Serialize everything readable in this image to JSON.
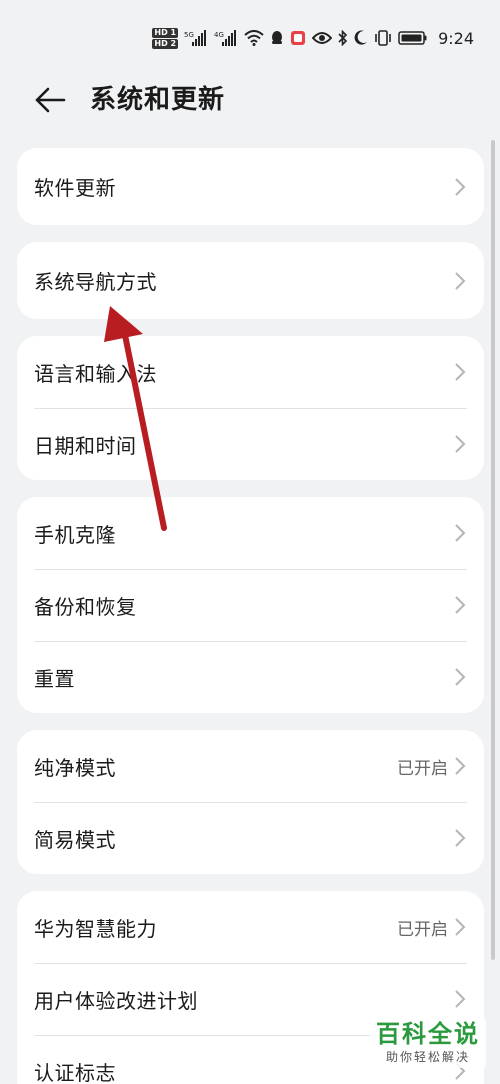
{
  "status_bar": {
    "hd_labels": [
      "HD 1",
      "HD 2"
    ],
    "network_1": "5G",
    "network_2": "4G",
    "time": "9:24",
    "icons": [
      "hd-icon",
      "signal-5g-icon",
      "signal-4g-icon",
      "wifi-icon",
      "qq-icon",
      "app-notification-icon",
      "eye-comfort-icon",
      "bluetooth-icon",
      "moon-icon",
      "vibrate-icon",
      "battery-icon"
    ]
  },
  "header": {
    "title": "系统和更新",
    "back_icon": "back-arrow-icon"
  },
  "cards": [
    {
      "rows": [
        {
          "label": "软件更新",
          "value": ""
        }
      ]
    },
    {
      "rows": [
        {
          "label": "系统导航方式",
          "value": ""
        }
      ]
    },
    {
      "rows": [
        {
          "label": "语言和输入法",
          "value": ""
        },
        {
          "label": "日期和时间",
          "value": ""
        }
      ]
    },
    {
      "rows": [
        {
          "label": "手机克隆",
          "value": ""
        },
        {
          "label": "备份和恢复",
          "value": ""
        },
        {
          "label": "重置",
          "value": ""
        }
      ]
    },
    {
      "rows": [
        {
          "label": "纯净模式",
          "value": "已开启"
        },
        {
          "label": "简易模式",
          "value": ""
        }
      ]
    },
    {
      "rows": [
        {
          "label": "华为智慧能力",
          "value": "已开启"
        },
        {
          "label": "用户体验改进计划",
          "value": ""
        },
        {
          "label": "认证标志",
          "value": ""
        }
      ]
    }
  ],
  "annotation": {
    "color": "#b81d22"
  },
  "watermark": {
    "main": "百科全说",
    "sub": "助你轻松解决"
  }
}
